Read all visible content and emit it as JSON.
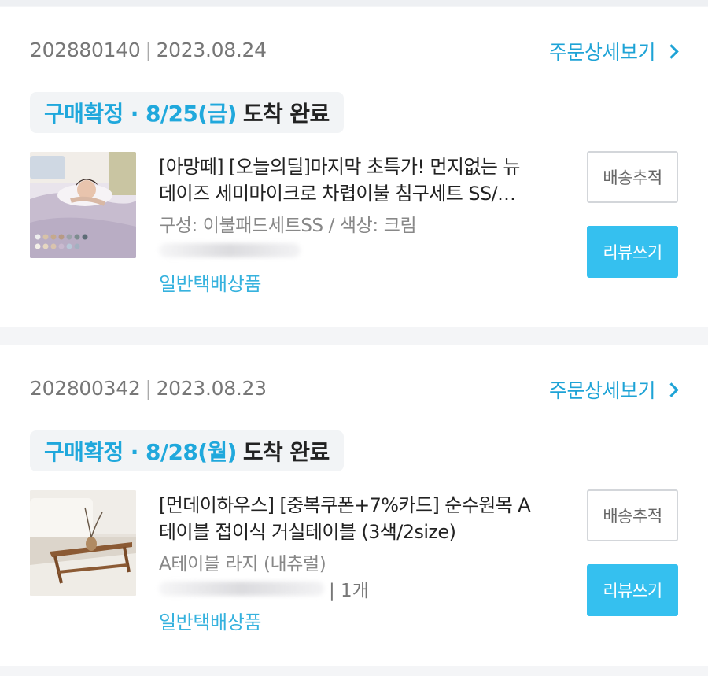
{
  "orders": [
    {
      "order_no": "202880140",
      "order_date": "2023.08.24",
      "detail_link": "주문상세보기",
      "status_blue": "구매확정 · 8/25(금)",
      "status_dark": "도착 완료",
      "title_line1": "[아망떼] [오늘의딜]마지막 초특가! 먼지없는 뉴",
      "title_line2": "데이즈 세미마이크로 차렵이불 침구세트 SS/…",
      "option": "구성: 이불패드세트SS / 색상: 크림",
      "quantity": "",
      "shipping": "일반택배상품",
      "btn_track": "배송추적",
      "btn_review": "리뷰쓰기"
    },
    {
      "order_no": "202800342",
      "order_date": "2023.08.23",
      "detail_link": "주문상세보기",
      "status_blue": "구매확정 · 8/28(월)",
      "status_dark": "도착 완료",
      "title_line1": "[먼데이하우스] [중복쿠폰+7%카드] 순수원목 A",
      "title_line2": "테이블 접이식 거실테이블 (3색/2size)",
      "option": "A테이블 라지 (내츄럴)",
      "quantity": "| 1개",
      "shipping": "일반택배상품",
      "btn_track": "배송추적",
      "btn_review": "리뷰쓰기"
    }
  ],
  "icons": {
    "detail": "chevron-right-icon"
  },
  "colors": {
    "accent": "#1ea3d6",
    "button": "#35c0ef",
    "status_bg": "#f2f4f6"
  }
}
